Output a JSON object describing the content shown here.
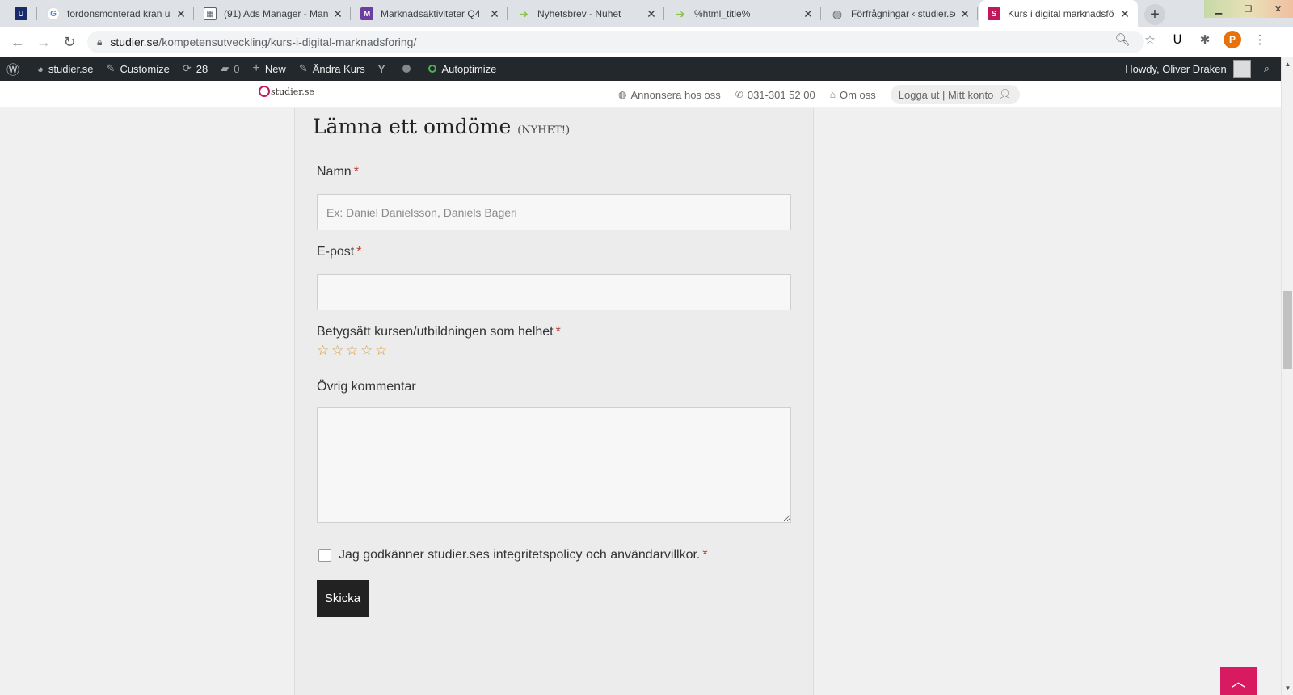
{
  "browser": {
    "tabs": [
      {
        "favicon": "U",
        "favicon_color": "#1a2b6b",
        "title": ""
      },
      {
        "favicon": "G",
        "favicon_color": "#4285f4",
        "title": "fordonsmonterad kran u"
      },
      {
        "favicon": "ads",
        "favicon_color": "#5f6368",
        "title": "(91) Ads Manager - Man"
      },
      {
        "favicon": "M",
        "favicon_color": "#6b3fa0",
        "title": "Marknadsaktiviteter Q4"
      },
      {
        "favicon": "arrow",
        "favicon_color": "#8bc34a",
        "title": "Nyhetsbrev - Nuhet"
      },
      {
        "favicon": "arrow",
        "favicon_color": "#8bc34a",
        "title": "%html_title%"
      },
      {
        "favicon": "globe",
        "favicon_color": "#5f6368",
        "title": "Förfrågningar ‹ studier.se"
      },
      {
        "favicon": "S",
        "favicon_color": "#c2185b",
        "title": "Kurs i digital marknadsfö"
      }
    ],
    "new_tab_label": "+",
    "url_host": "studier.se",
    "url_path": "/kompetensutveckling/kurs-i-digital-marknadsforing/",
    "profile_initial": "P",
    "profile_color": "#e8710a"
  },
  "adminbar": {
    "site_name": "studier.se",
    "customize": "Customize",
    "updates_count": "28",
    "comments_count": "0",
    "new_label": "New",
    "edit_label": "Ändra Kurs",
    "autoptimize": "Autoptimize",
    "greeting": "Howdy, Oliver Draken"
  },
  "site_header": {
    "logo_text": "studier.se",
    "advertise": "Annonsera hos oss",
    "phone": "031-301 52 00",
    "about": "Om oss",
    "account": "Logga ut | Mitt konto"
  },
  "review_form": {
    "heading": "Lämna ett omdöme",
    "heading_badge": "(NYHET!)",
    "name_label": "Namn",
    "name_placeholder": "Ex: Daniel Danielsson, Daniels Bageri",
    "email_label": "E-post",
    "rating_label": "Betygsätt kursen/utbildningen som helhet",
    "rating_value": 0,
    "rating_max": 5,
    "comment_label": "Övrig kommentar",
    "consent_label": "Jag godkänner studier.ses integritetspolicy och användarvillkor.",
    "required_mark": "*",
    "submit_label": "Skicka"
  },
  "colors": {
    "brand": "#c2185b",
    "star": "#d99a3b",
    "required": "#c0392b",
    "adminbar": "#23282d"
  }
}
